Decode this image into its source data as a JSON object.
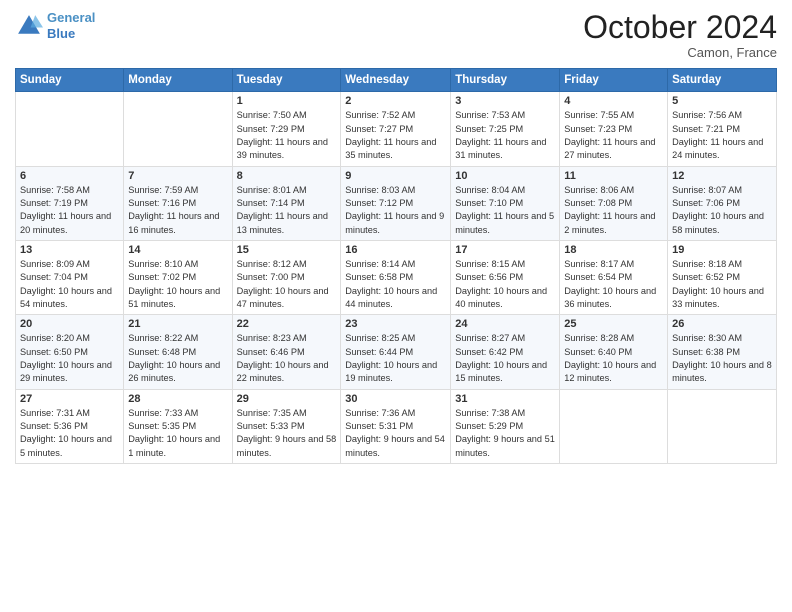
{
  "header": {
    "logo_line1": "General",
    "logo_line2": "Blue",
    "month": "October 2024",
    "location": "Camon, France"
  },
  "weekdays": [
    "Sunday",
    "Monday",
    "Tuesday",
    "Wednesday",
    "Thursday",
    "Friday",
    "Saturday"
  ],
  "weeks": [
    [
      {
        "day": "",
        "sunrise": "",
        "sunset": "",
        "daylight": ""
      },
      {
        "day": "",
        "sunrise": "",
        "sunset": "",
        "daylight": ""
      },
      {
        "day": "1",
        "sunrise": "Sunrise: 7:50 AM",
        "sunset": "Sunset: 7:29 PM",
        "daylight": "Daylight: 11 hours and 39 minutes."
      },
      {
        "day": "2",
        "sunrise": "Sunrise: 7:52 AM",
        "sunset": "Sunset: 7:27 PM",
        "daylight": "Daylight: 11 hours and 35 minutes."
      },
      {
        "day": "3",
        "sunrise": "Sunrise: 7:53 AM",
        "sunset": "Sunset: 7:25 PM",
        "daylight": "Daylight: 11 hours and 31 minutes."
      },
      {
        "day": "4",
        "sunrise": "Sunrise: 7:55 AM",
        "sunset": "Sunset: 7:23 PM",
        "daylight": "Daylight: 11 hours and 27 minutes."
      },
      {
        "day": "5",
        "sunrise": "Sunrise: 7:56 AM",
        "sunset": "Sunset: 7:21 PM",
        "daylight": "Daylight: 11 hours and 24 minutes."
      }
    ],
    [
      {
        "day": "6",
        "sunrise": "Sunrise: 7:58 AM",
        "sunset": "Sunset: 7:19 PM",
        "daylight": "Daylight: 11 hours and 20 minutes."
      },
      {
        "day": "7",
        "sunrise": "Sunrise: 7:59 AM",
        "sunset": "Sunset: 7:16 PM",
        "daylight": "Daylight: 11 hours and 16 minutes."
      },
      {
        "day": "8",
        "sunrise": "Sunrise: 8:01 AM",
        "sunset": "Sunset: 7:14 PM",
        "daylight": "Daylight: 11 hours and 13 minutes."
      },
      {
        "day": "9",
        "sunrise": "Sunrise: 8:03 AM",
        "sunset": "Sunset: 7:12 PM",
        "daylight": "Daylight: 11 hours and 9 minutes."
      },
      {
        "day": "10",
        "sunrise": "Sunrise: 8:04 AM",
        "sunset": "Sunset: 7:10 PM",
        "daylight": "Daylight: 11 hours and 5 minutes."
      },
      {
        "day": "11",
        "sunrise": "Sunrise: 8:06 AM",
        "sunset": "Sunset: 7:08 PM",
        "daylight": "Daylight: 11 hours and 2 minutes."
      },
      {
        "day": "12",
        "sunrise": "Sunrise: 8:07 AM",
        "sunset": "Sunset: 7:06 PM",
        "daylight": "Daylight: 10 hours and 58 minutes."
      }
    ],
    [
      {
        "day": "13",
        "sunrise": "Sunrise: 8:09 AM",
        "sunset": "Sunset: 7:04 PM",
        "daylight": "Daylight: 10 hours and 54 minutes."
      },
      {
        "day": "14",
        "sunrise": "Sunrise: 8:10 AM",
        "sunset": "Sunset: 7:02 PM",
        "daylight": "Daylight: 10 hours and 51 minutes."
      },
      {
        "day": "15",
        "sunrise": "Sunrise: 8:12 AM",
        "sunset": "Sunset: 7:00 PM",
        "daylight": "Daylight: 10 hours and 47 minutes."
      },
      {
        "day": "16",
        "sunrise": "Sunrise: 8:14 AM",
        "sunset": "Sunset: 6:58 PM",
        "daylight": "Daylight: 10 hours and 44 minutes."
      },
      {
        "day": "17",
        "sunrise": "Sunrise: 8:15 AM",
        "sunset": "Sunset: 6:56 PM",
        "daylight": "Daylight: 10 hours and 40 minutes."
      },
      {
        "day": "18",
        "sunrise": "Sunrise: 8:17 AM",
        "sunset": "Sunset: 6:54 PM",
        "daylight": "Daylight: 10 hours and 36 minutes."
      },
      {
        "day": "19",
        "sunrise": "Sunrise: 8:18 AM",
        "sunset": "Sunset: 6:52 PM",
        "daylight": "Daylight: 10 hours and 33 minutes."
      }
    ],
    [
      {
        "day": "20",
        "sunrise": "Sunrise: 8:20 AM",
        "sunset": "Sunset: 6:50 PM",
        "daylight": "Daylight: 10 hours and 29 minutes."
      },
      {
        "day": "21",
        "sunrise": "Sunrise: 8:22 AM",
        "sunset": "Sunset: 6:48 PM",
        "daylight": "Daylight: 10 hours and 26 minutes."
      },
      {
        "day": "22",
        "sunrise": "Sunrise: 8:23 AM",
        "sunset": "Sunset: 6:46 PM",
        "daylight": "Daylight: 10 hours and 22 minutes."
      },
      {
        "day": "23",
        "sunrise": "Sunrise: 8:25 AM",
        "sunset": "Sunset: 6:44 PM",
        "daylight": "Daylight: 10 hours and 19 minutes."
      },
      {
        "day": "24",
        "sunrise": "Sunrise: 8:27 AM",
        "sunset": "Sunset: 6:42 PM",
        "daylight": "Daylight: 10 hours and 15 minutes."
      },
      {
        "day": "25",
        "sunrise": "Sunrise: 8:28 AM",
        "sunset": "Sunset: 6:40 PM",
        "daylight": "Daylight: 10 hours and 12 minutes."
      },
      {
        "day": "26",
        "sunrise": "Sunrise: 8:30 AM",
        "sunset": "Sunset: 6:38 PM",
        "daylight": "Daylight: 10 hours and 8 minutes."
      }
    ],
    [
      {
        "day": "27",
        "sunrise": "Sunrise: 7:31 AM",
        "sunset": "Sunset: 5:36 PM",
        "daylight": "Daylight: 10 hours and 5 minutes."
      },
      {
        "day": "28",
        "sunrise": "Sunrise: 7:33 AM",
        "sunset": "Sunset: 5:35 PM",
        "daylight": "Daylight: 10 hours and 1 minute."
      },
      {
        "day": "29",
        "sunrise": "Sunrise: 7:35 AM",
        "sunset": "Sunset: 5:33 PM",
        "daylight": "Daylight: 9 hours and 58 minutes."
      },
      {
        "day": "30",
        "sunrise": "Sunrise: 7:36 AM",
        "sunset": "Sunset: 5:31 PM",
        "daylight": "Daylight: 9 hours and 54 minutes."
      },
      {
        "day": "31",
        "sunrise": "Sunrise: 7:38 AM",
        "sunset": "Sunset: 5:29 PM",
        "daylight": "Daylight: 9 hours and 51 minutes."
      },
      {
        "day": "",
        "sunrise": "",
        "sunset": "",
        "daylight": ""
      },
      {
        "day": "",
        "sunrise": "",
        "sunset": "",
        "daylight": ""
      }
    ]
  ]
}
